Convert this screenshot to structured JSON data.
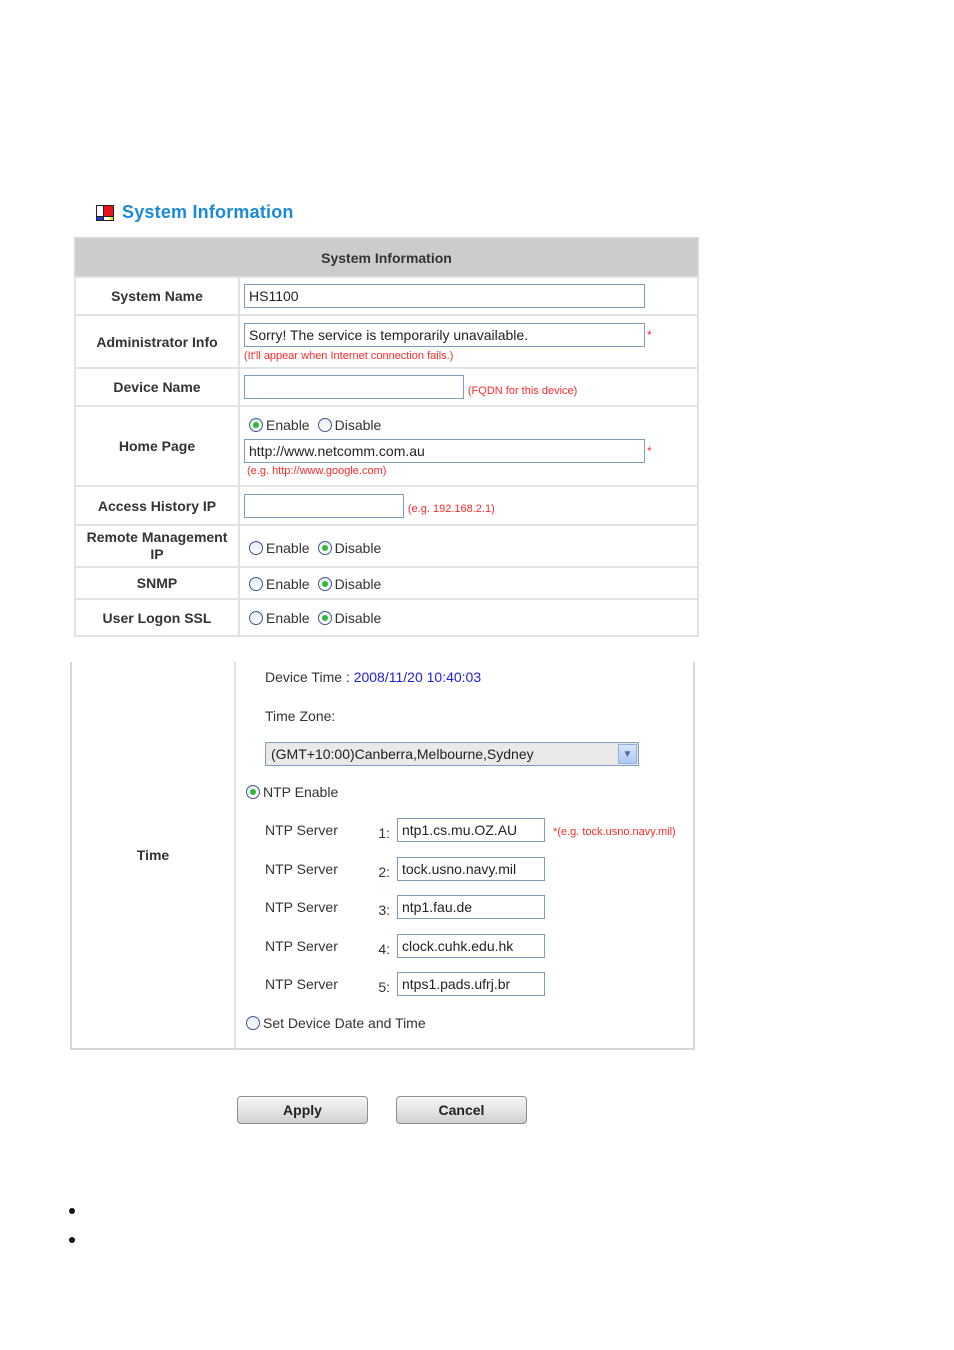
{
  "heading": {
    "icon": "system-info-icon",
    "title": "System Information"
  },
  "system_table": {
    "header": "System Information",
    "rows": {
      "system_name": {
        "label": "System Name",
        "value": "HS1100"
      },
      "admin_info": {
        "label": "Administrator Info",
        "value": "Sorry! The service is temporarily unavailable.",
        "required_mark": "*",
        "hint": "(It'll appear when Internet connection fails.)"
      },
      "device_name": {
        "label": "Device Name",
        "value": "",
        "hint": "(FQDN for this device)"
      },
      "home_page": {
        "label": "Home Page",
        "options": [
          "Enable",
          "Disable"
        ],
        "selected": "Enable",
        "value": "http://www.netcomm.com.au",
        "required_mark": "*",
        "hint": "(e.g. http://www.google.com)"
      },
      "access_history_ip": {
        "label": "Access History IP",
        "value": "",
        "hint": "(e.g. 192.168.2.1)"
      },
      "remote_mgmt_ip": {
        "label": "Remote Management IP",
        "options": [
          "Enable",
          "Disable"
        ],
        "selected": "Disable"
      },
      "snmp": {
        "label": "SNMP",
        "options": [
          "Enable",
          "Disable"
        ],
        "selected": "Disable"
      },
      "user_logon_ssl": {
        "label": "User Logon SSL",
        "options": [
          "Enable",
          "Disable"
        ],
        "selected": "Disable"
      }
    }
  },
  "time_table": {
    "label": "Time",
    "device_time_label": "Device Time : ",
    "device_time_value": "2008/11/20 10:40:03",
    "time_zone_label": "Time Zone:",
    "time_zone_selected": "(GMT+10:00)Canberra,Melbourne,Sydney",
    "ntp_enable_label": "NTP Enable",
    "ntp_enable_selected": true,
    "ntp_server_label": "NTP Server",
    "ntp_servers": [
      {
        "num": "1:",
        "value": "ntp1.cs.mu.OZ.AU"
      },
      {
        "num": "2:",
        "value": "tock.usno.navy.mil"
      },
      {
        "num": "3:",
        "value": "ntp1.fau.de"
      },
      {
        "num": "4:",
        "value": "clock.cuhk.edu.hk"
      },
      {
        "num": "5:",
        "value": "ntps1.pads.ufrj.br"
      }
    ],
    "ntp_hint": "*(e.g. tock.usno.navy.mil)",
    "set_date_label": "Set Device Date and Time",
    "set_date_selected": false
  },
  "buttons": {
    "apply": "Apply",
    "cancel": "Cancel"
  }
}
